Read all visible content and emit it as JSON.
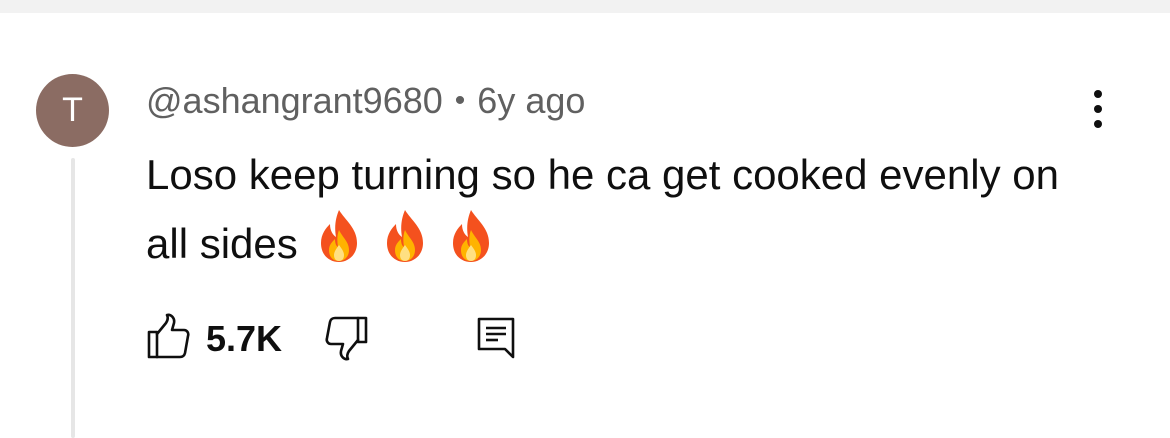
{
  "colors": {
    "avatar_bg": "#8b6c63",
    "secondary_text": "#606060",
    "primary_text": "#0f0f0f"
  },
  "comment": {
    "avatar_letter": "T",
    "author": "@ashangrant9680",
    "separator": "•",
    "timestamp": "6y ago",
    "text": "Loso keep turning so he ca get cooked evenly on all sides",
    "emojis": [
      "fire-emoji",
      "fire-emoji",
      "fire-emoji"
    ],
    "like_count": "5.7K"
  },
  "icons": {
    "more": "more-vertical-icon",
    "like": "thumbs-up-icon",
    "dislike": "thumbs-down-icon",
    "reply": "reply-comment-icon"
  }
}
